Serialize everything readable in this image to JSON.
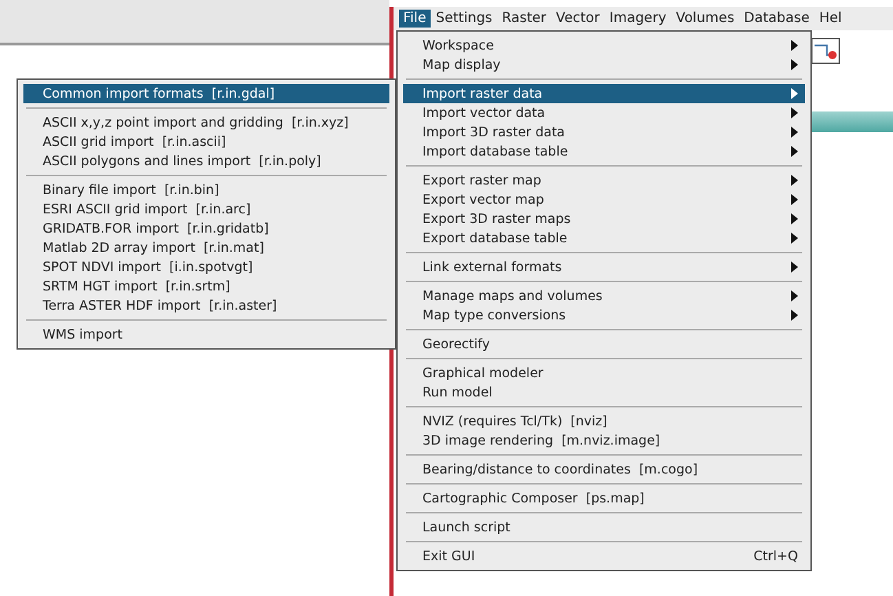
{
  "menubar": [
    {
      "label": "File",
      "selected": true
    },
    {
      "label": "Settings",
      "selected": false
    },
    {
      "label": "Raster",
      "selected": false
    },
    {
      "label": "Vector",
      "selected": false
    },
    {
      "label": "Imagery",
      "selected": false
    },
    {
      "label": "Volumes",
      "selected": false
    },
    {
      "label": "Database",
      "selected": false
    },
    {
      "label": "Hel",
      "selected": false
    }
  ],
  "file_menu": [
    [
      {
        "label": "Workspace",
        "submenu": true,
        "selected": false
      },
      {
        "label": "Map display",
        "submenu": true,
        "selected": false
      }
    ],
    [
      {
        "label": "Import raster data",
        "submenu": true,
        "selected": true
      },
      {
        "label": "Import vector data",
        "submenu": true,
        "selected": false
      },
      {
        "label": "Import 3D raster data",
        "submenu": true,
        "selected": false
      },
      {
        "label": "Import database table",
        "submenu": true,
        "selected": false
      }
    ],
    [
      {
        "label": "Export raster map",
        "submenu": true,
        "selected": false
      },
      {
        "label": "Export vector map",
        "submenu": true,
        "selected": false
      },
      {
        "label": "Export 3D raster maps",
        "submenu": true,
        "selected": false
      },
      {
        "label": "Export database table",
        "submenu": true,
        "selected": false
      }
    ],
    [
      {
        "label": "Link external formats",
        "submenu": true,
        "selected": false
      }
    ],
    [
      {
        "label": "Manage maps and volumes",
        "submenu": true,
        "selected": false
      },
      {
        "label": "Map type conversions",
        "submenu": true,
        "selected": false
      }
    ],
    [
      {
        "label": "Georectify",
        "submenu": false,
        "selected": false
      }
    ],
    [
      {
        "label": "Graphical modeler",
        "submenu": false,
        "selected": false
      },
      {
        "label": "Run model",
        "submenu": false,
        "selected": false
      }
    ],
    [
      {
        "label": "NVIZ (requires Tcl/Tk)  [nviz]",
        "submenu": false,
        "selected": false
      },
      {
        "label": "3D image rendering  [m.nviz.image]",
        "submenu": false,
        "selected": false
      }
    ],
    [
      {
        "label": "Bearing/distance to coordinates  [m.cogo]",
        "submenu": false,
        "selected": false
      }
    ],
    [
      {
        "label": "Cartographic Composer  [ps.map]",
        "submenu": false,
        "selected": false
      }
    ],
    [
      {
        "label": "Launch script",
        "submenu": false,
        "selected": false
      }
    ],
    [
      {
        "label": "Exit GUI",
        "submenu": false,
        "selected": false,
        "shortcut": "Ctrl+Q"
      }
    ]
  ],
  "import_raster_submenu": [
    [
      {
        "label": "Common import formats  [r.in.gdal]",
        "selected": true
      }
    ],
    [
      {
        "label": "ASCII x,y,z point import and gridding  [r.in.xyz]",
        "selected": false
      },
      {
        "label": "ASCII grid import  [r.in.ascii]",
        "selected": false
      },
      {
        "label": "ASCII polygons and lines import  [r.in.poly]",
        "selected": false
      }
    ],
    [
      {
        "label": "Binary file import  [r.in.bin]",
        "selected": false
      },
      {
        "label": "ESRI ASCII grid import  [r.in.arc]",
        "selected": false
      },
      {
        "label": "GRIDATB.FOR import  [r.in.gridatb]",
        "selected": false
      },
      {
        "label": "Matlab 2D array import  [r.in.mat]",
        "selected": false
      },
      {
        "label": "SPOT NDVI import  [i.in.spotvgt]",
        "selected": false
      },
      {
        "label": "SRTM HGT import  [r.in.srtm]",
        "selected": false
      },
      {
        "label": "Terra ASTER HDF import  [r.in.aster]",
        "selected": false
      }
    ],
    [
      {
        "label": "WMS import",
        "selected": false
      }
    ]
  ]
}
